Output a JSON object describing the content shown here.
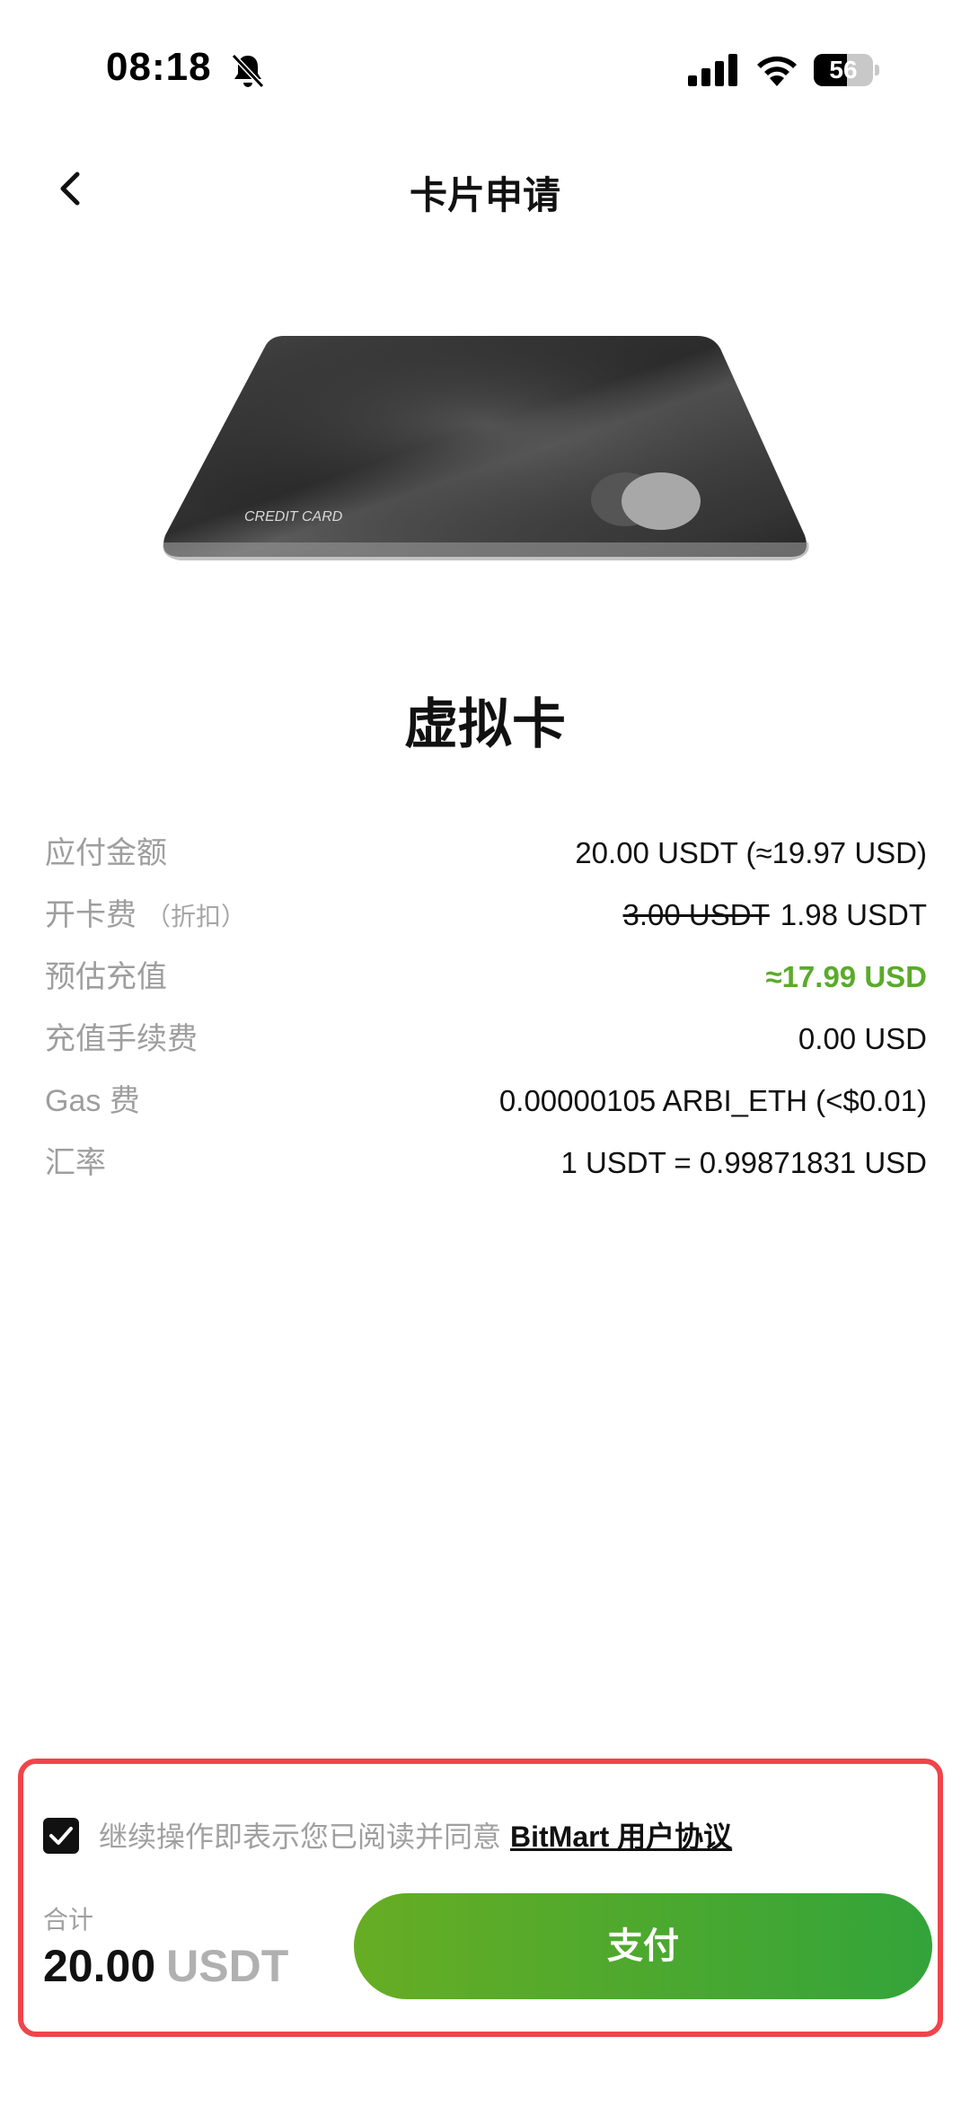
{
  "status_bar": {
    "time": "08:18",
    "battery_level": "56",
    "icons": [
      "bell-slash-icon",
      "cellular-signal-icon",
      "wifi-icon",
      "battery-icon"
    ]
  },
  "header": {
    "title": "卡片申请",
    "back_icon": "chevron-left-icon"
  },
  "card": {
    "label": "CREDIT CARD",
    "type_title": "虚拟卡"
  },
  "details": [
    {
      "label": "应付金额",
      "value": "20.00 USDT (≈19.97 USD)"
    },
    {
      "label": "开卡费",
      "note": "（折扣）",
      "original": "3.00 USDT",
      "value": "1.98 USDT"
    },
    {
      "label": "预估充值",
      "value": "≈17.99 USD",
      "accent": "#5aab2a"
    },
    {
      "label": "充值手续费",
      "value": "0.00 USD"
    },
    {
      "label": "Gas 费",
      "value": "0.00000105 ARBI_ETH (<$0.01)"
    },
    {
      "label": "汇率",
      "value": "1 USDT = 0.99871831 USD"
    }
  ],
  "footer": {
    "agreement_text": "继续操作即表示您已阅读并同意",
    "agreement_link": "BitMart 用户协议",
    "agreement_checked": true,
    "total_label": "合计",
    "total_amount": "20.00",
    "total_unit": "USDT",
    "pay_label": "支付"
  },
  "colors": {
    "highlight_border": "#f0444b",
    "pay_gradient_start": "#67ad23",
    "pay_gradient_end": "#33a43a"
  }
}
